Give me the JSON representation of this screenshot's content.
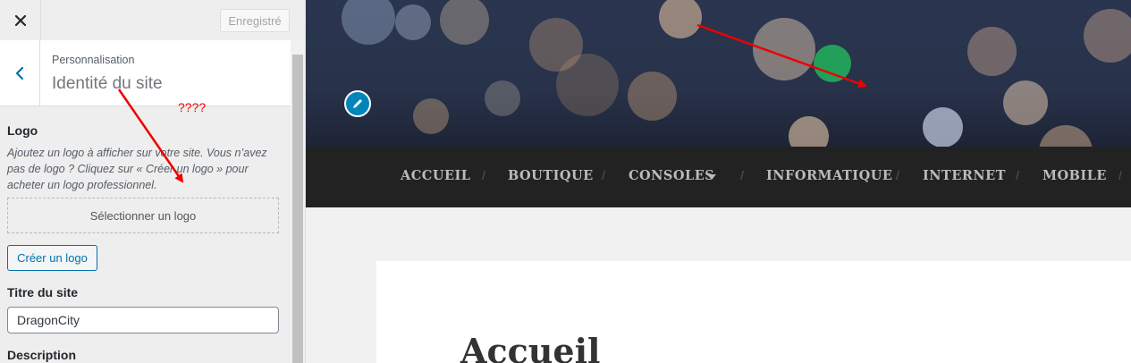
{
  "sidebar": {
    "close_icon": "close-icon",
    "saved_label": "Enregistré",
    "back_icon": "chevron-left-icon",
    "crumb": "Personnalisation",
    "section_title": "Identité du site",
    "logo": {
      "label": "Logo",
      "description": "Ajoutez un logo à afficher sur votre site. Vous n’avez pas de logo ? Cliquez sur « Créer un logo » pour acheter un logo professionnel.",
      "select_button": "Sélectionner un logo",
      "create_button": "Créer un logo"
    },
    "site_title": {
      "label": "Titre du site",
      "value": "DragonCity"
    },
    "description_label": "Description"
  },
  "preview": {
    "edit_icon": "pencil-icon",
    "nav": [
      {
        "label": "ACCUEIL"
      },
      {
        "label": "BOUTIQUE"
      },
      {
        "label": "CONSOLES"
      },
      {
        "label": "INFORMATIQUE"
      },
      {
        "label": "INTERNET"
      },
      {
        "label": "MOBILE"
      }
    ],
    "nav_dropdown_icon": "caret-down-icon",
    "separator": "/",
    "page_heading": "Accueil"
  },
  "annotation": {
    "text": "????",
    "color": "#e00000"
  }
}
